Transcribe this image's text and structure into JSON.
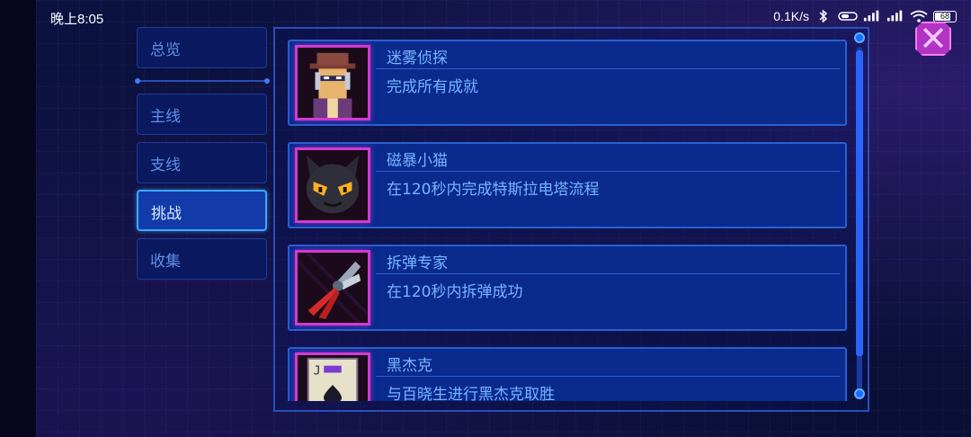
{
  "status_bar": {
    "time": "晚上8:05",
    "network_speed": "0.1K/s",
    "battery_level": "68"
  },
  "sidebar": {
    "tabs": [
      {
        "label": "总览",
        "active": false
      },
      {
        "label": "主线",
        "active": false
      },
      {
        "label": "支线",
        "active": false
      },
      {
        "label": "挑战",
        "active": true
      },
      {
        "label": "收集",
        "active": false
      }
    ]
  },
  "achievements": [
    {
      "title": "迷雾侦探",
      "description": "完成所有成就",
      "icon": "detective-icon"
    },
    {
      "title": "磁暴小猫",
      "description": "在120秒内完成特斯拉电塔流程",
      "icon": "black-cat-icon"
    },
    {
      "title": "拆弹专家",
      "description": "在120秒内拆弹成功",
      "icon": "pliers-icon"
    },
    {
      "title": "黑杰克",
      "description": "与百晓生进行黑杰克取胜",
      "icon": "playing-card-icon"
    }
  ],
  "colors": {
    "accent": "#3aa9ff",
    "card_bg": "#0a2a8e",
    "icon_border": "#d23ad0",
    "close_button": "#b233c4"
  }
}
